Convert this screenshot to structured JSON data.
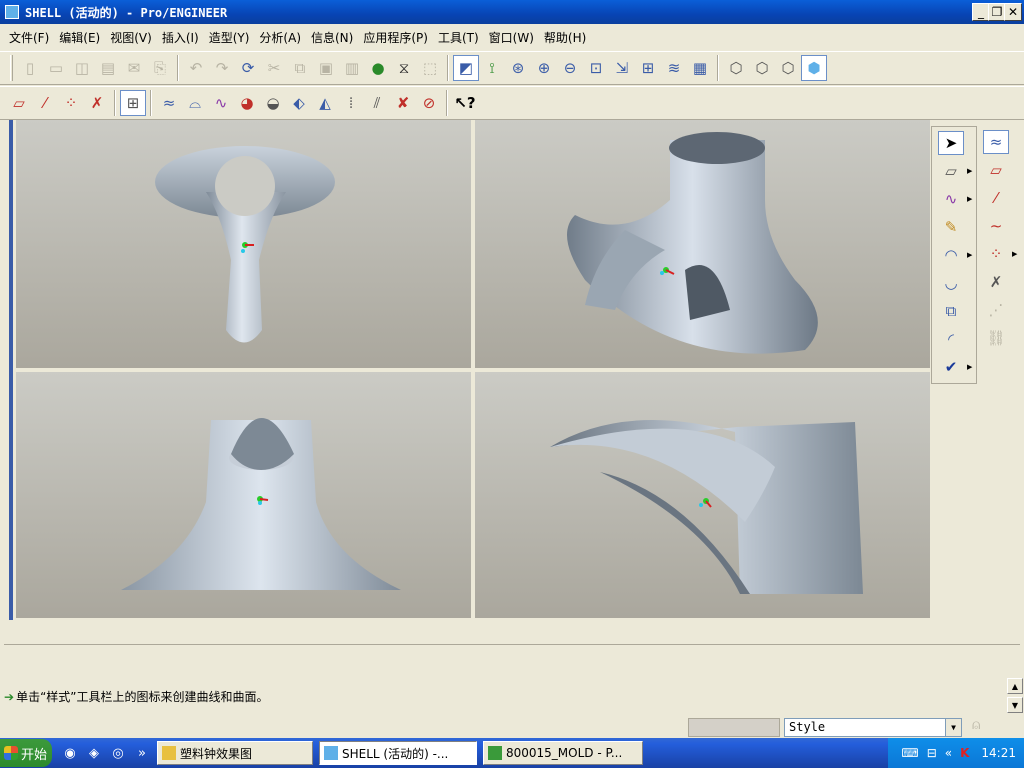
{
  "window": {
    "title": "SHELL (活动的) - Pro/ENGINEER",
    "minimize": "_",
    "restore": "❐",
    "close": "✕"
  },
  "menu": [
    {
      "label": "文件(F)"
    },
    {
      "label": "编辑(E)"
    },
    {
      "label": "视图(V)"
    },
    {
      "label": "插入(I)"
    },
    {
      "label": "造型(Y)"
    },
    {
      "label": "分析(A)"
    },
    {
      "label": "信息(N)"
    },
    {
      "label": "应用程序(P)"
    },
    {
      "label": "工具(T)"
    },
    {
      "label": "窗口(W)"
    },
    {
      "label": "帮助(H)"
    }
  ],
  "toolbar1": {
    "file": [
      "new-icon",
      "open-icon",
      "save-icon",
      "print-icon",
      "email-icon",
      "send-icon"
    ],
    "edit": [
      "undo-icon",
      "redo-icon",
      "regenerate-icon",
      "cut-icon",
      "copy-icon",
      "paste-icon",
      "paste-special-icon",
      "model-tree-icon",
      "find-icon",
      "selection-box-icon"
    ],
    "view": [
      "repaint-icon",
      "datum-display-icon",
      "orient-icon",
      "zoom-in-icon",
      "zoom-out-icon",
      "refit-icon",
      "reorient-icon",
      "saved-views-icon",
      "layers-icon",
      "view-manager-icon"
    ],
    "display": [
      "wireframe-icon",
      "hidden-line-icon",
      "no-hidden-icon",
      "shading-icon"
    ]
  },
  "toolbar2": {
    "datum": [
      "datum-plane-icon",
      "datum-axis-icon",
      "datum-point-icon",
      "coordinate-system-icon"
    ],
    "style": [
      "style-icon",
      "curve-analysis-icon",
      "curvature-icon",
      "reflection-icon",
      "shade-analysis-icon",
      "draft-analysis-icon",
      "slope-icon",
      "section-icon",
      "offset-icon",
      "dihedral-icon",
      "deviation-icon"
    ],
    "help": [
      "whats-this-icon"
    ]
  },
  "right_toolbar1": [
    "select-icon",
    "plane-icon",
    "curve-icon",
    "curve-edit-icon",
    "surface-icon",
    "surface-connect-icon",
    "surface-trim-icon",
    "surface-edit-icon",
    "done-icon"
  ],
  "right_toolbar2": [
    "datum-curve-icon",
    "datum-plane-icon",
    "datum-axis-icon",
    "sketch-icon",
    "point-icon",
    "point-off-icon",
    "csys-icon",
    "chain-icon"
  ],
  "status": {
    "message": "单击“样式”工具栏上的图标来创建曲线和曲面。",
    "style_value": "Style"
  },
  "taskbar": {
    "start_label": "开始",
    "quicklaunch_more": "»",
    "tasks": [
      {
        "label": "塑料钟效果图",
        "active": false
      },
      {
        "label": "SHELL (活动的) -...",
        "active": true
      },
      {
        "label": "800015_MOLD - P...",
        "active": false
      }
    ],
    "tray_arrow": "«",
    "clock": "14:21"
  },
  "colors": {
    "title_bar": "#0a5fd8",
    "viewport_top": "#cbcbc5",
    "viewport_bottom": "#aaa79d",
    "model": "#b8c4d0",
    "taskbar": "#245edb",
    "start": "#3c9a3c"
  }
}
